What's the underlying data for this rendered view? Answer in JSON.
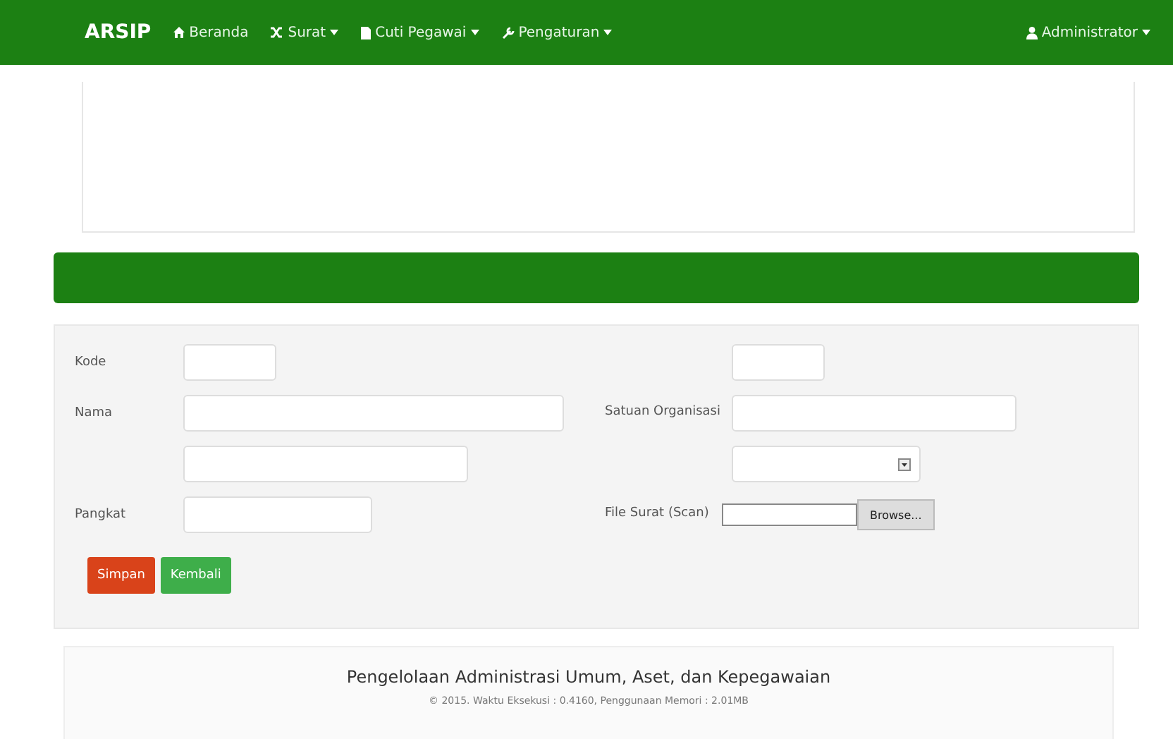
{
  "navbar": {
    "brand": "ARSIP",
    "menu": [
      {
        "label": "Beranda",
        "dropdown": false
      },
      {
        "label": "Surat",
        "dropdown": true
      },
      {
        "label": "Cuti Pegawai",
        "dropdown": true
      },
      {
        "label": "Pengaturan",
        "dropdown": true
      }
    ],
    "user": {
      "label": "Administrator",
      "dropdown": true
    }
  },
  "form": {
    "left": [
      {
        "kind": "input",
        "label": "Kode"
      },
      {
        "kind": "input",
        "label": "Nama"
      },
      {
        "kind": "input"
      },
      {
        "kind": "input",
        "label": "Pangkat"
      }
    ],
    "right": [
      {
        "kind": "input"
      },
      {
        "kind": "input",
        "label": "Satuan Organisasi"
      },
      {
        "kind": "select"
      },
      {
        "kind": "file",
        "label": "File Surat (Scan)",
        "button": "Browse..."
      }
    ],
    "buttons": [
      {
        "label": "Simpan",
        "kind": "danger"
      },
      {
        "label": "Kembali",
        "kind": "success"
      }
    ]
  },
  "footer": {
    "title": "Pengelolaan Administrasi Umum, Aset, dan Kepegawaian",
    "note": "© 2015. Waktu Eksekusi : 0.4160, Penggunaan Memori : 2.01MB"
  }
}
